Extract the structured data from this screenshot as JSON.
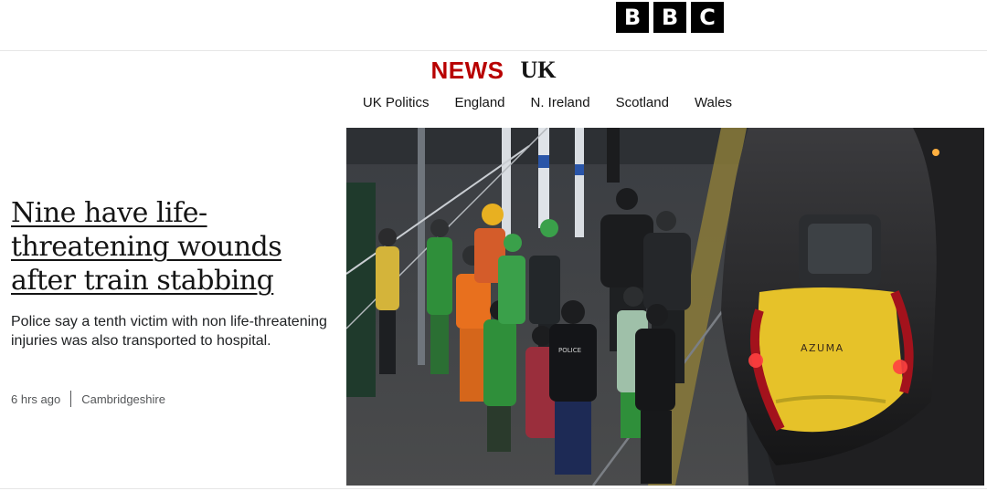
{
  "brand": {
    "letters": [
      "B",
      "B",
      "C"
    ]
  },
  "masthead": {
    "news": "NEWS",
    "section": "UK"
  },
  "nav": {
    "items": [
      "UK Politics",
      "England",
      "N. Ireland",
      "Scotland",
      "Wales"
    ]
  },
  "story": {
    "headline": "Nine have life-threatening wounds after train stabbing",
    "summary": "Police say a tenth victim with non life-threatening injuries was also transported to hospital.",
    "time": "6 hrs ago",
    "topic": "Cambridgeshire"
  },
  "photo": {
    "train_logo": "AZUMA",
    "vest_text": "POLICE"
  },
  "colors": {
    "news_red": "#b80000",
    "train_yellow": "#e6c229",
    "train_red": "#a3121c",
    "hi_vis_green": "#2f8f3a",
    "hi_vis_orange": "#e8701e"
  }
}
